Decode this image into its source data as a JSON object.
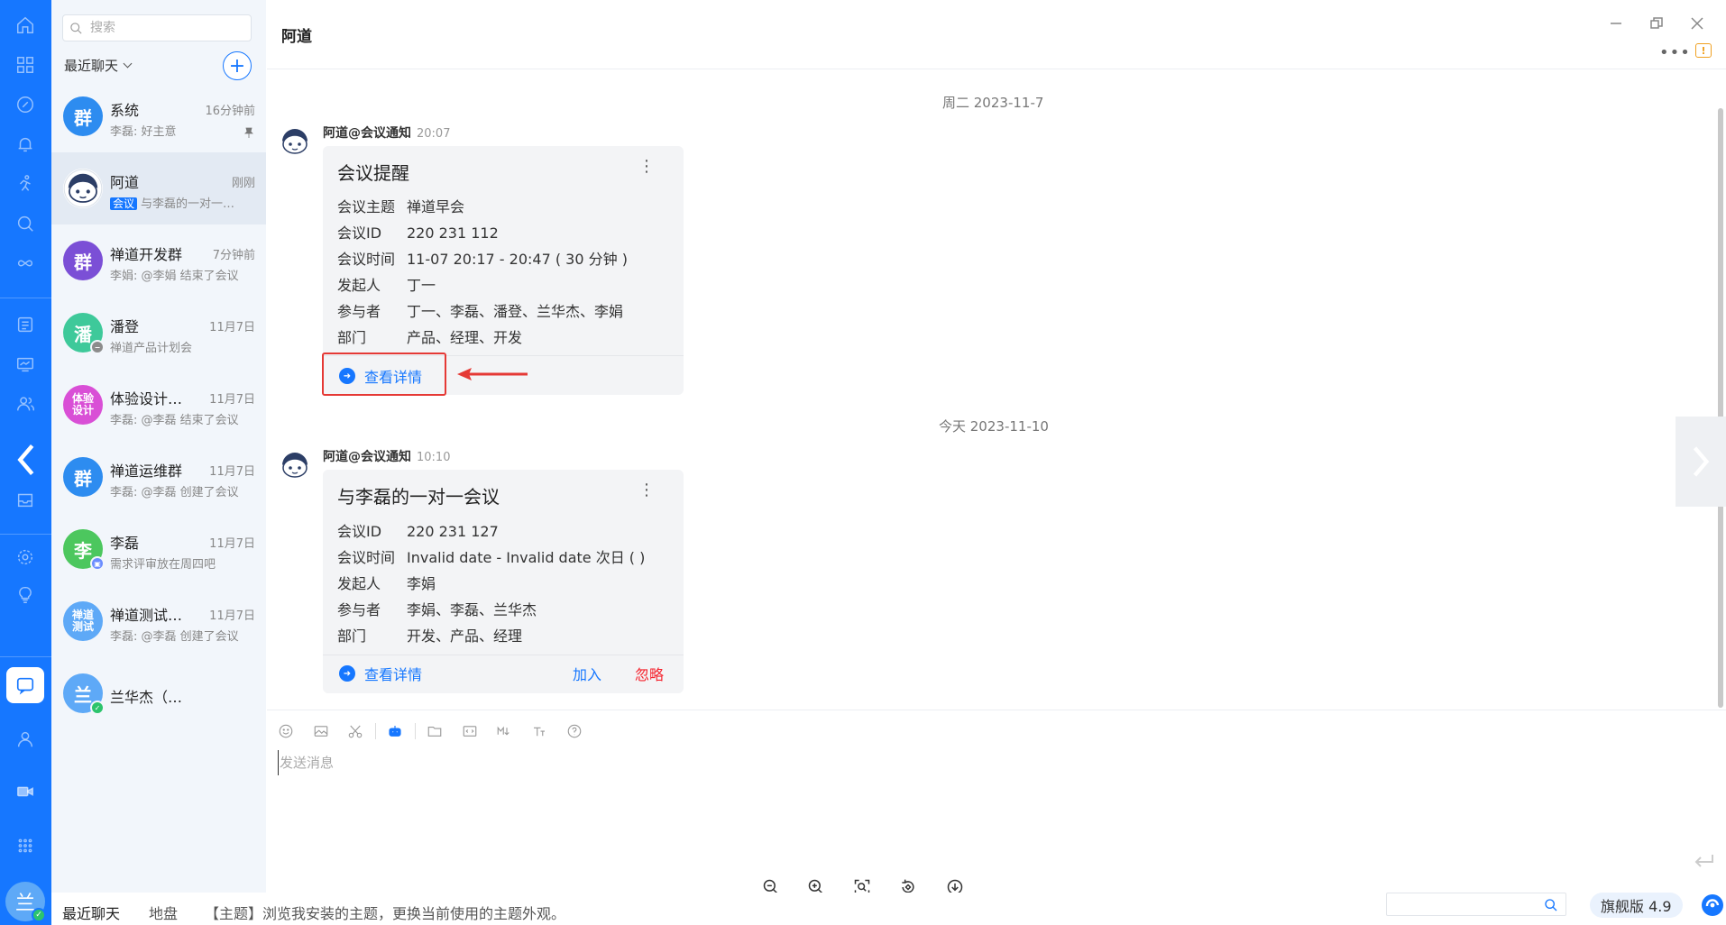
{
  "search": {
    "placeholder": "搜索"
  },
  "list_filter": "最近聊天",
  "chats": [
    {
      "name": "系统",
      "time": "16分钟前",
      "preview": "李磊: 好主意",
      "avatar_text": "群",
      "avatar_color": "#2d8cf0",
      "pinned": true
    },
    {
      "name": "阿道",
      "time": "刚刚",
      "tag": "会议",
      "preview": "与李磊的一对一会议",
      "avatar_text": "",
      "avatar_color": "#ffffff",
      "selected": true
    },
    {
      "name": "禅道开发群",
      "time": "7分钟前",
      "preview": "李娟: @李娟 结束了会议",
      "avatar_text": "群",
      "avatar_color": "#7b4fd6"
    },
    {
      "name": "潘登",
      "time": "11月7日",
      "preview": "禅道产品计划会",
      "avatar_text": "潘",
      "avatar_color": "#3ec99a",
      "badge": "minus"
    },
    {
      "name": "体验设计部门",
      "time": "11月7日",
      "preview": "李磊: @李磊 结束了会议",
      "avatar_text": "体验\n设计",
      "avatar_color": "#d94fd6"
    },
    {
      "name": "禅道运维群",
      "time": "11月7日",
      "preview": "李磊: @李磊 创建了会议",
      "avatar_text": "群",
      "avatar_color": "#2d8cf0"
    },
    {
      "name": "李磊",
      "time": "11月7日",
      "preview": "需求评审放在周四吧",
      "avatar_text": "李",
      "avatar_color": "#4cc75e",
      "badge": "device"
    },
    {
      "name": "禅道测试群组",
      "time": "11月7日",
      "preview": "李磊: @李磊 创建了会议",
      "avatar_text": "禅道\n测试",
      "avatar_color": "#5ea9f7"
    },
    {
      "name": "兰华杰（我）",
      "time": "",
      "preview": "",
      "avatar_text": "兰",
      "avatar_color": "#5ea9f7",
      "badge": "ok"
    }
  ],
  "header": {
    "title": "阿道"
  },
  "messages": [
    {
      "date": "周二 2023-11-7",
      "sender": "阿道@会议通知",
      "time": "20:07",
      "card": {
        "title": "会议提醒",
        "rows": [
          {
            "k": "会议主题",
            "v": "禅道早会"
          },
          {
            "k": "会议ID",
            "v": "220 231 112"
          },
          {
            "k": "会议时间",
            "v": "11-07 20:17 - 20:47 ( 30 分钟 )"
          },
          {
            "k": "发起人",
            "v": "丁一"
          },
          {
            "k": "参与者",
            "v": "丁一、李磊、潘登、兰华杰、李娟"
          },
          {
            "k": "部门",
            "v": "产品、经理、开发"
          }
        ],
        "detail_label": "查看详情"
      }
    },
    {
      "date": "今天 2023-11-10",
      "sender": "阿道@会议通知",
      "time": "10:10",
      "card": {
        "title": "与李磊的一对一会议",
        "rows": [
          {
            "k": "会议ID",
            "v": "220 231 127"
          },
          {
            "k": "会议时间",
            "v": "Invalid date - Invalid date 次日 ( )"
          },
          {
            "k": "发起人",
            "v": "李娟"
          },
          {
            "k": "参与者",
            "v": "李娟、李磊、兰华杰"
          },
          {
            "k": "部门",
            "v": "开发、产品、经理"
          }
        ],
        "detail_label": "查看详情",
        "join_label": "加入",
        "ignore_label": "忽略"
      }
    }
  ],
  "composer": {
    "placeholder": "发送消息"
  },
  "status": {
    "tab_recent": "最近聊天",
    "tab_disk": "地盘",
    "tip": "【主题】浏览我安装的主题，更换当前使用的主题外观。",
    "version": "旗舰版 4.9"
  },
  "user_avatar_text": "兰",
  "colors": {
    "brand": "#1677ff",
    "danger": "#f5222d"
  }
}
